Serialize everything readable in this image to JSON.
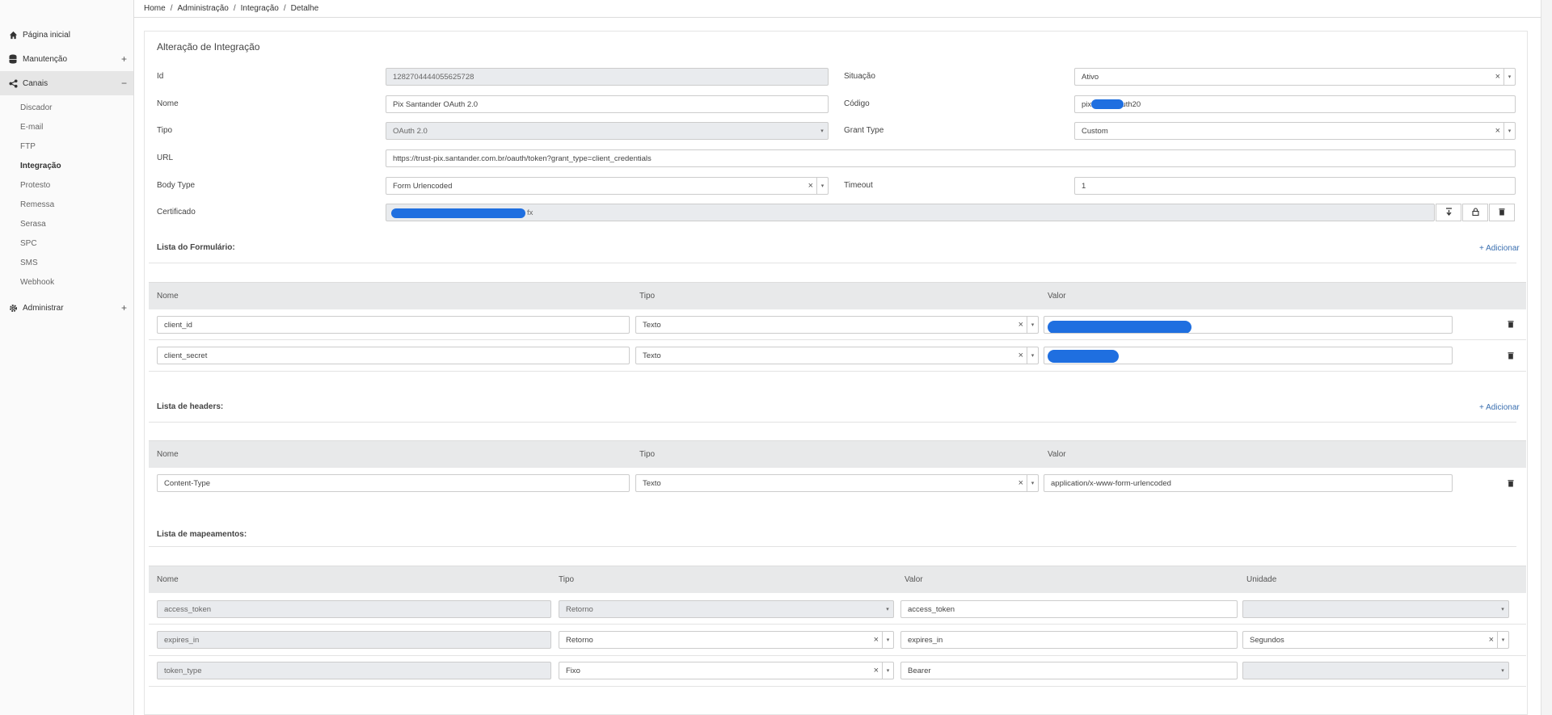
{
  "sidebar": {
    "home": "Página inicial",
    "manutencao": "Manutenção",
    "canais": "Canais",
    "canais_items": [
      "Discador",
      "E-mail",
      "FTP",
      "Integração",
      "Protesto",
      "Remessa",
      "Serasa",
      "SPC",
      "SMS",
      "Webhook"
    ],
    "administrar": "Administrar",
    "plus": "+",
    "minus": "−"
  },
  "breadcrumb": {
    "items": [
      "Home",
      "Administração",
      "Integração",
      "Detalhe"
    ],
    "sep": "/"
  },
  "form": {
    "title": "Alteração de Integração",
    "id_label": "Id",
    "id_value": "1282704444055625728",
    "situacao_label": "Situação",
    "situacao_value": "Ativo",
    "nome_label": "Nome",
    "nome_value": "Pix Santander OAuth 2.0",
    "codigo_label": "Código",
    "codigo_prefix": "pix",
    "codigo_suffix": "auth20",
    "tipo_label": "Tipo",
    "tipo_value": "OAuth 2.0",
    "grant_label": "Grant Type",
    "grant_value": "Custom",
    "url_label": "URL",
    "url_value": "https://trust-pix.santander.com.br/oauth/token?grant_type=client_credentials",
    "body_label": "Body Type",
    "body_value": "Form Urlencoded",
    "timeout_label": "Timeout",
    "timeout_value": "1",
    "cert_label": "Certificado",
    "cert_suffix": "fx"
  },
  "formulario": {
    "title": "Lista do Formulário:",
    "add": "+ Adicionar",
    "headers": [
      "Nome",
      "Tipo",
      "Valor"
    ],
    "rows": [
      {
        "nome": "client_id",
        "tipo": "Texto"
      },
      {
        "nome": "client_secret",
        "tipo": "Texto"
      }
    ]
  },
  "headers_list": {
    "title": "Lista de headers:",
    "add": "+ Adicionar",
    "headers": [
      "Nome",
      "Tipo",
      "Valor"
    ],
    "rows": [
      {
        "nome": "Content-Type",
        "tipo": "Texto",
        "valor": "application/x-www-form-urlencoded"
      }
    ]
  },
  "mapeamentos": {
    "title": "Lista de mapeamentos:",
    "headers": [
      "Nome",
      "Tipo",
      "Valor",
      "Unidade"
    ],
    "rows": [
      {
        "nome": "access_token",
        "tipo": "Retorno",
        "valor": "access_token",
        "unidade": ""
      },
      {
        "nome": "expires_in",
        "tipo": "Retorno",
        "valor": "expires_in",
        "unidade": "Segundos"
      },
      {
        "nome": "token_type",
        "tipo": "Fixo",
        "valor": "Bearer",
        "unidade": ""
      }
    ]
  },
  "glyphs": {
    "clear": "×",
    "caret": "▾"
  },
  "colors": {
    "redaction": "#1f6fe0",
    "link": "#3a6fb0"
  }
}
